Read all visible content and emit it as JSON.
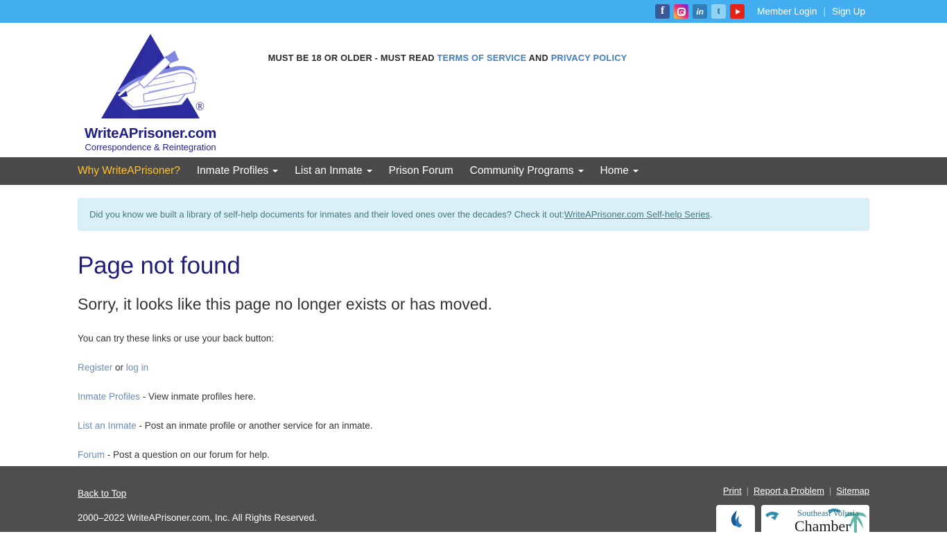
{
  "topbar": {
    "social": [
      {
        "name": "facebook-icon",
        "label": "f"
      },
      {
        "name": "instagram-icon",
        "label": ""
      },
      {
        "name": "linkedin-icon",
        "label": "in"
      },
      {
        "name": "twitter-icon",
        "label": "t"
      },
      {
        "name": "youtube-icon",
        "label": ""
      }
    ],
    "member_login": "Member Login",
    "separator": "|",
    "sign_up": "Sign Up",
    "background_color": "#42aeef"
  },
  "header": {
    "logo": {
      "name": "WriteAPrisoner.com",
      "tagline": "Correspondence & Reintegration",
      "registered_mark": "®"
    },
    "age_notice": {
      "prefix": "MUST BE 18 OR OLDER - MUST READ ",
      "terms_link": "TERMS OF SERVICE",
      "middle": " AND ",
      "privacy_link": "PRIVACY POLICY"
    }
  },
  "nav": {
    "background_color": "#4a4a4c",
    "highlight_color": "#ffc425",
    "items": [
      {
        "label": "Why WriteAPrisoner?",
        "caret": false,
        "highlight": true
      },
      {
        "label": "Inmate Profiles",
        "caret": true,
        "highlight": false
      },
      {
        "label": "List an Inmate",
        "caret": true,
        "highlight": false
      },
      {
        "label": "Prison Forum",
        "caret": false,
        "highlight": false
      },
      {
        "label": "Community Programs",
        "caret": true,
        "highlight": false
      },
      {
        "label": "Home",
        "caret": true,
        "highlight": false
      }
    ]
  },
  "notice": {
    "text": "Did you know we built a library of self-help documents for inmates and their loved ones over the decades? Check it out: ",
    "link": "WriteAPrisoner.com Self-help Series",
    "suffix": ".",
    "background_color": "#d9f0f7"
  },
  "main": {
    "title": "Page not found",
    "subtitle": "Sorry, it looks like this page no longer exists or has moved.",
    "lead": "You can try these links or use your back button:",
    "links": [
      {
        "link": "Register",
        "mid": " or ",
        "link2": "log in",
        "desc": ""
      },
      {
        "link": "Inmate Profiles",
        "desc": " - View inmate profiles here."
      },
      {
        "link": "List an Inmate",
        "desc": " - Post an inmate profile or another service for an inmate."
      },
      {
        "link": "Forum",
        "desc": " - Post a question on our forum for help."
      }
    ]
  },
  "footer": {
    "background_color": "#4e4e50",
    "back_to_top": "Back to Top",
    "copyright": "2000–2022 WriteAPrisoner.com, Inc. All Rights Reserved.",
    "print": "Print",
    "report": "Report a Problem",
    "sitemap": "Sitemap",
    "separator": "|",
    "badges": {
      "bbb": "BBB Accredited Business",
      "chamber_line1": "Southeast Volusia",
      "chamber_line2": "Chamber"
    }
  }
}
